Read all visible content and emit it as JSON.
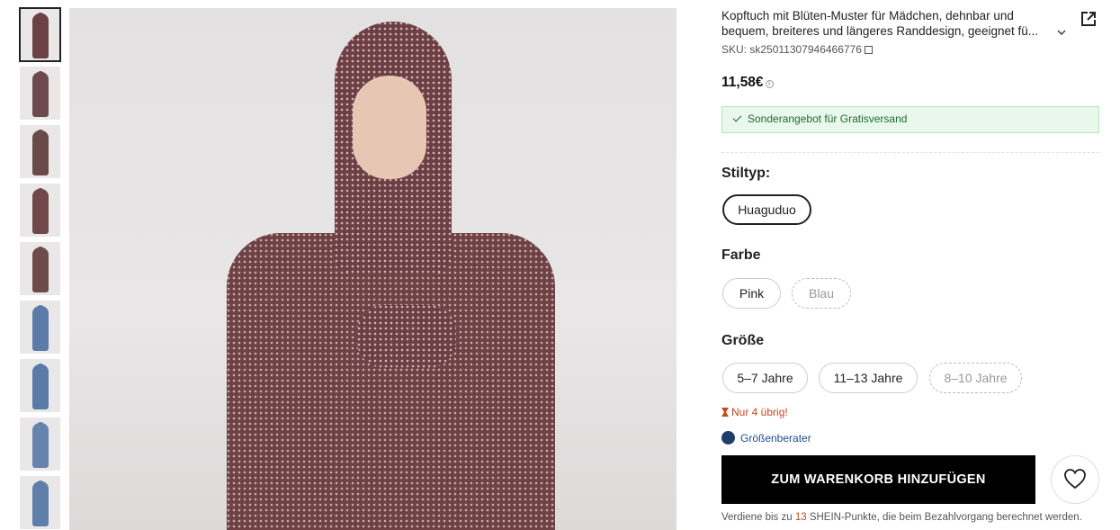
{
  "gallery": {
    "thumbnails": [
      {
        "name": "thumbnail-1",
        "color": "#6b4145",
        "active": true
      },
      {
        "name": "thumbnail-2",
        "color": "#6e4a4c",
        "active": false
      },
      {
        "name": "thumbnail-3",
        "color": "#6a4a48",
        "active": false
      },
      {
        "name": "thumbnail-4",
        "color": "#70484a",
        "active": false
      },
      {
        "name": "thumbnail-5",
        "color": "#6d4b4a",
        "active": false
      },
      {
        "name": "thumbnail-6",
        "color": "#5b7ba8",
        "active": false
      },
      {
        "name": "thumbnail-7",
        "color": "#5a7aa8",
        "active": false
      },
      {
        "name": "thumbnail-8",
        "color": "#6683ad",
        "active": false
      },
      {
        "name": "thumbnail-9",
        "color": "#5f7fab",
        "active": false
      }
    ]
  },
  "product": {
    "title": "Kopftuch mit Blüten-Muster für Mädchen, dehnbar und bequem, breiteres und längeres Randdesign, geeignet fü...",
    "sku_label": "SKU: sk25011307946466776",
    "price": "11,58€",
    "promo": "Sonderangebot für Gratisversand"
  },
  "style": {
    "label": "Stiltyp:",
    "options": [
      {
        "label": "Huaguduo",
        "state": "selected"
      }
    ]
  },
  "color": {
    "label": "Farbe",
    "options": [
      {
        "label": "Pink",
        "state": "normal"
      },
      {
        "label": "Blau",
        "state": "disabled"
      }
    ]
  },
  "size": {
    "label": "Größe",
    "options": [
      {
        "label": "5–7 Jahre",
        "state": "normal"
      },
      {
        "label": "11–13 Jahre",
        "state": "normal"
      },
      {
        "label": "8–10 Jahre",
        "state": "disabled"
      }
    ]
  },
  "stock": {
    "text": "Nur 4 übrig!"
  },
  "advisor": {
    "text": "Größenberater"
  },
  "actions": {
    "add_to_cart": "ZUM WARENKORB HINZUFÜGEN"
  },
  "points": {
    "prefix": "Verdiene bis zu ",
    "number": "13",
    "suffix": " SHEIN-Punkte, die beim Bezahlvorgang berechnet werden."
  },
  "colors": {
    "accent": "#c44a1f",
    "promo_bg": "#e8f8ec",
    "promo_text": "#1d6b30",
    "link": "#1c4e8a"
  }
}
